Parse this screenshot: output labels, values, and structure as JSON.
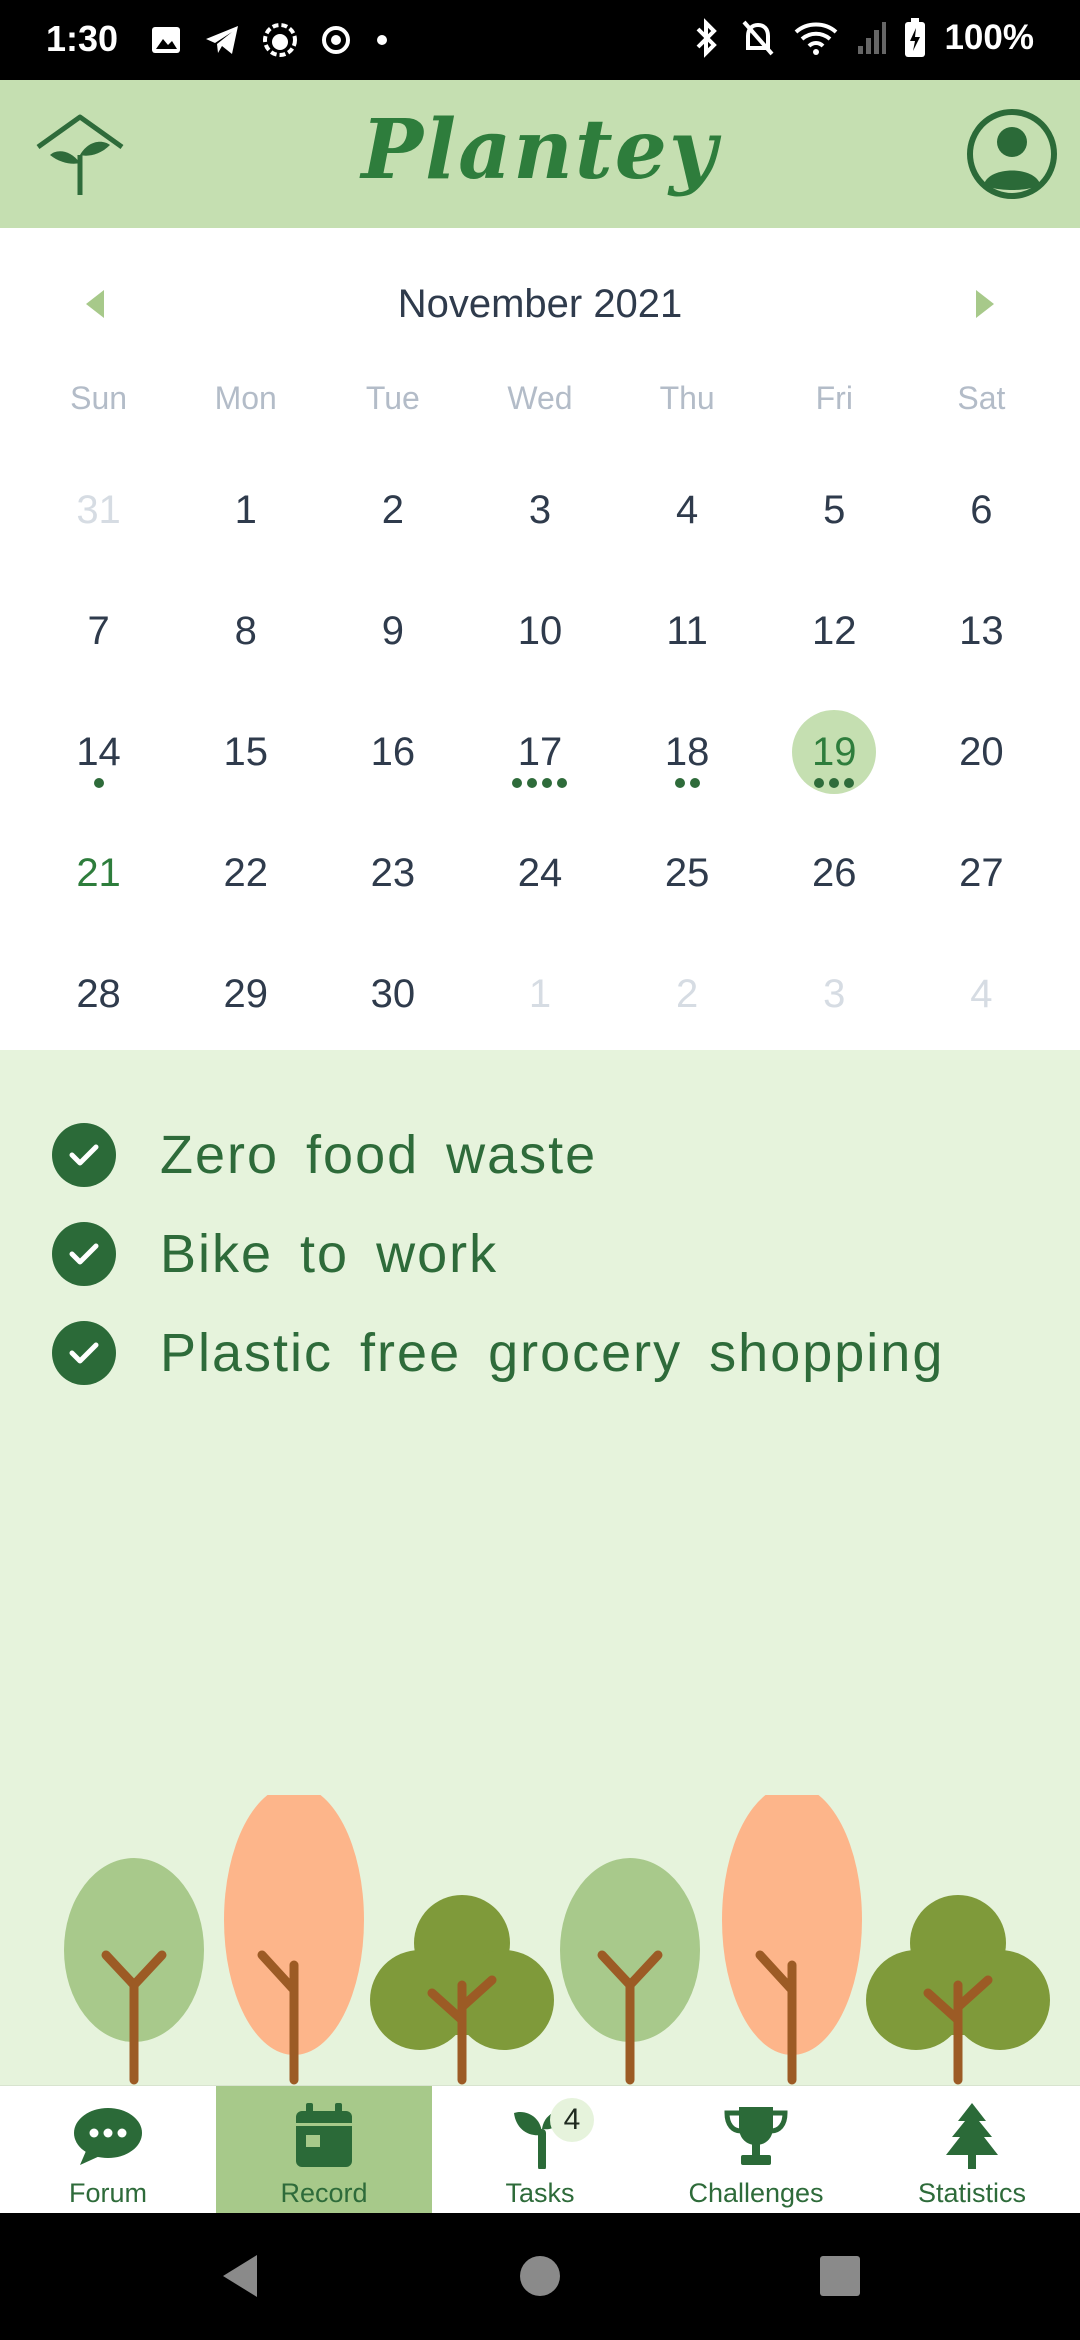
{
  "status_bar": {
    "time": "1:30",
    "battery": "100%"
  },
  "header": {
    "title": "Plantey"
  },
  "calendar": {
    "month_label": "November 2021",
    "weekdays": [
      "Sun",
      "Mon",
      "Tue",
      "Wed",
      "Thu",
      "Fri",
      "Sat"
    ],
    "days": [
      {
        "label": "31",
        "outside": true,
        "dots": 0
      },
      {
        "label": "1",
        "dots": 0
      },
      {
        "label": "2",
        "dots": 0
      },
      {
        "label": "3",
        "dots": 0
      },
      {
        "label": "4",
        "dots": 0
      },
      {
        "label": "5",
        "dots": 0
      },
      {
        "label": "6",
        "dots": 0
      },
      {
        "label": "7",
        "dots": 0
      },
      {
        "label": "8",
        "dots": 0
      },
      {
        "label": "9",
        "dots": 0
      },
      {
        "label": "10",
        "dots": 0
      },
      {
        "label": "11",
        "dots": 0
      },
      {
        "label": "12",
        "dots": 0
      },
      {
        "label": "13",
        "dots": 0
      },
      {
        "label": "14",
        "dots": 1
      },
      {
        "label": "15",
        "dots": 0
      },
      {
        "label": "16",
        "dots": 0
      },
      {
        "label": "17",
        "dots": 4
      },
      {
        "label": "18",
        "dots": 2
      },
      {
        "label": "19",
        "dots": 3,
        "selected": true
      },
      {
        "label": "20",
        "dots": 0
      },
      {
        "label": "21",
        "dots": 0,
        "today": true
      },
      {
        "label": "22",
        "dots": 0
      },
      {
        "label": "23",
        "dots": 0
      },
      {
        "label": "24",
        "dots": 0
      },
      {
        "label": "25",
        "dots": 0
      },
      {
        "label": "26",
        "dots": 0
      },
      {
        "label": "27",
        "dots": 0
      },
      {
        "label": "28",
        "dots": 0
      },
      {
        "label": "29",
        "dots": 0
      },
      {
        "label": "30",
        "dots": 0
      },
      {
        "label": "1",
        "outside": true,
        "dots": 0
      },
      {
        "label": "2",
        "outside": true,
        "dots": 0
      },
      {
        "label": "3",
        "outside": true,
        "dots": 0
      },
      {
        "label": "4",
        "outside": true,
        "dots": 0
      }
    ]
  },
  "completed_tasks": [
    "Zero food waste",
    "Bike to work",
    "Plastic free grocery shopping"
  ],
  "bottom_nav": [
    {
      "label": "Forum",
      "icon": "chat-bubble-icon"
    },
    {
      "label": "Record",
      "icon": "calendar-icon",
      "active": true
    },
    {
      "label": "Tasks",
      "icon": "sprout-icon",
      "badge": "4"
    },
    {
      "label": "Challenges",
      "icon": "trophy-icon"
    },
    {
      "label": "Statistics",
      "icon": "pine-tree-icon"
    }
  ],
  "colors": {
    "header_bg": "#c5dfb1",
    "accent_green": "#2e7d3c",
    "task_bg": "#e6f3dc",
    "nav_active_bg": "#a7c98a"
  }
}
